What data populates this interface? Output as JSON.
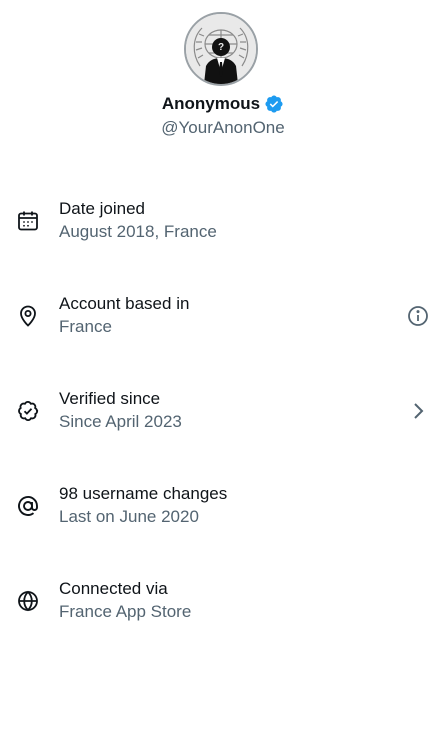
{
  "profile": {
    "display_name": "Anonymous",
    "handle": "@YourAnonOne",
    "verified": true,
    "badge_color": "#1d9bf0"
  },
  "about": [
    {
      "icon": "calendar-icon",
      "title": "Date joined",
      "subtitle": "August 2018, France"
    },
    {
      "icon": "location-pin-icon",
      "title": "Account based in",
      "subtitle": "France",
      "action_icon": "info-icon"
    },
    {
      "icon": "verified-badge-icon",
      "title": "Verified since",
      "subtitle": "Since April 2023",
      "action_icon": "chevron-right-icon"
    },
    {
      "icon": "at-sign-icon",
      "title": "98 username changes",
      "subtitle": "Last on June 2020"
    },
    {
      "icon": "globe-icon",
      "title": "Connected via",
      "subtitle": "France App Store"
    }
  ],
  "colors": {
    "text_primary": "#0f1419",
    "text_secondary": "#536471"
  }
}
